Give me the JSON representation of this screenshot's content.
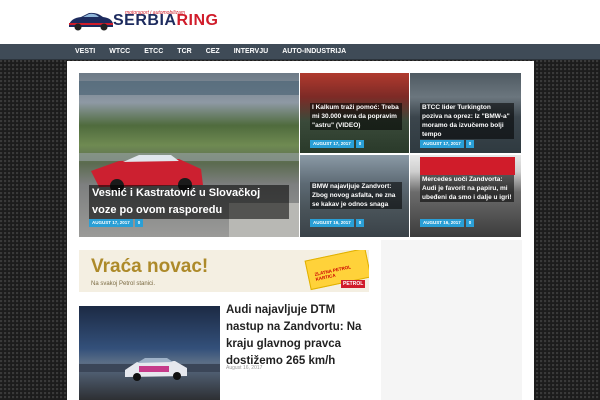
{
  "logo": {
    "name_part1": "SERBIA",
    "name_part2": "RING",
    "tagline": "motorsport i automobilizam"
  },
  "nav": {
    "items": [
      "VESTI",
      "WTCC",
      "ETCC",
      "TCR",
      "CEZ",
      "INTERVJU",
      "AUTO-INDUSTRIJA"
    ]
  },
  "featured": {
    "main": {
      "title": "Vesnić i Kastratović u Slovačkoj voze po ovom rasporedu",
      "date": "AUGUST 17, 2017",
      "comments": "0"
    },
    "tiles": [
      {
        "title": "I Kalkum traži pomoć: Treba mi 30.000 evra da popravim \"astru\" (VIDEO)",
        "date": "AUGUST 17, 2017",
        "comments": "0"
      },
      {
        "title": "BTCC lider Turkington poziva na oprez: Iz \"BMW-a\" moramo da izvučemo bolji tempo",
        "date": "AUGUST 17, 2017",
        "comments": "0"
      },
      {
        "title": "BMW najavljuje Zandvort: Zbog novog asfalta, ne zna se kakav je odnos snaga",
        "date": "AUGUST 16, 2017",
        "comments": "0"
      },
      {
        "title": "Mercedes uoči Zandvorta: Audi je favorit na papiru, mi ubeđeni da smo i dalje u igri!",
        "date": "AUGUST 16, 2017",
        "comments": "0"
      }
    ]
  },
  "banner": {
    "title": "Vraća novac!",
    "subtitle": "Na svakoj Petrol stanici.",
    "card_text": "ZLATNA PETROL KARTICA",
    "brand": "PETROL"
  },
  "article": {
    "title": "Audi najavljuje DTM nastup na Zandvortu: Na kraju glavnog pravca dostižemo 265 km/h",
    "date": "August 16, 2017"
  },
  "colors": {
    "accent": "#2a9fd6",
    "nav_bg": "#3f4b57",
    "brand_red": "#d01c2a"
  }
}
